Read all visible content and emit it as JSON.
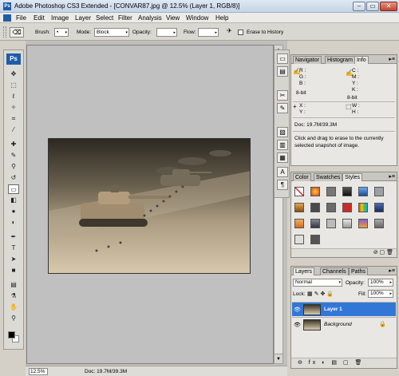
{
  "window": {
    "title": "Adobe Photoshop CS3 Extended - [CONVAR87.jpg @ 12.5% (Layer 1, RGB/8)]",
    "app_icon": "Ps",
    "min_label": "–",
    "max_label": "▭",
    "close_label": "✕"
  },
  "menu": [
    "File",
    "Edit",
    "Image",
    "Layer",
    "Select",
    "Filter",
    "Analysis",
    "View",
    "Window",
    "Help"
  ],
  "options": {
    "brush_label": "Brush:",
    "brush_size": "•",
    "mode_label": "Mode:",
    "mode_value": "Block",
    "opacity_label": "Opacity:",
    "opacity_value": "",
    "flow_label": "Flow:",
    "flow_value": "",
    "erase_history_label": "Erase to History",
    "tool_icon": "eraser-icon"
  },
  "toolbox": {
    "logo": "Ps",
    "tools": [
      {
        "name": "move-tool-icon",
        "glyph": "✥"
      },
      {
        "name": "marquee-tool-icon",
        "glyph": "⬚"
      },
      {
        "name": "lasso-tool-icon",
        "glyph": "ℓ"
      },
      {
        "name": "magic-wand-tool-icon",
        "glyph": "✧"
      },
      {
        "name": "crop-tool-icon",
        "glyph": "⌗"
      },
      {
        "name": "slice-tool-icon",
        "glyph": "⁄"
      },
      {
        "name": "healing-brush-tool-icon",
        "glyph": "✚"
      },
      {
        "name": "brush-tool-icon",
        "glyph": "✎"
      },
      {
        "name": "clone-stamp-tool-icon",
        "glyph": "⚲"
      },
      {
        "name": "history-brush-tool-icon",
        "glyph": "↺"
      },
      {
        "name": "eraser-tool-icon",
        "glyph": "▭"
      },
      {
        "name": "gradient-tool-icon",
        "glyph": "◧"
      },
      {
        "name": "blur-tool-icon",
        "glyph": "●"
      },
      {
        "name": "dodge-tool-icon",
        "glyph": "◐"
      },
      {
        "name": "pen-tool-icon",
        "glyph": "✒"
      },
      {
        "name": "type-tool-icon",
        "glyph": "T"
      },
      {
        "name": "path-selection-tool-icon",
        "glyph": "➤"
      },
      {
        "name": "shape-tool-icon",
        "glyph": "■"
      },
      {
        "name": "notes-tool-icon",
        "glyph": "▤"
      },
      {
        "name": "eyedropper-tool-icon",
        "glyph": "⚗"
      },
      {
        "name": "hand-tool-icon",
        "glyph": "✋"
      },
      {
        "name": "zoom-tool-icon",
        "glyph": "⚲"
      }
    ]
  },
  "status": {
    "zoom": "12.5%",
    "doc": "Doc: 19.7M/39.3M"
  },
  "info_panel": {
    "tabs": [
      "Navigator",
      "Histogram",
      "Info"
    ],
    "close_glyph": "×",
    "menu_glyph": "▸≡",
    "r": "R :",
    "g": "G :",
    "b": "B :",
    "c": "C :",
    "m": "M :",
    "y": "Y :",
    "k": "K :",
    "bit1": "8-bit",
    "bit2": "8-bit",
    "x": "X :",
    "y2": "Y :",
    "w": "W :",
    "h": "H :",
    "doc": "Doc: 19.7M/39.3M",
    "hint": "Click and drag to erase to the currently selected snapshot of image."
  },
  "styles_panel": {
    "tabs": [
      "Color",
      "Swatches",
      "Styles"
    ],
    "close_glyph": "×",
    "menu_glyph": "▸≡",
    "footer_icons": "⊘ ▢ 🗑"
  },
  "layers_panel": {
    "tabs": [
      "Layers",
      "Channels",
      "Paths"
    ],
    "close_glyph": "×",
    "menu_glyph": "▸≡",
    "blend_mode": "Normal",
    "opacity_label": "Opacity:",
    "opacity_value": "100%",
    "lock_label": "Lock:",
    "fill_label": "Fill:",
    "fill_value": "100%",
    "layers": [
      {
        "name": "Layer 1",
        "selected": true
      },
      {
        "name": "Background",
        "selected": false
      }
    ],
    "footer_icons": "⊖ fx ◐ ▤ ▢ 🗑"
  },
  "colors": {
    "accent": "#3277d6",
    "title_bar": "#c5d4e6"
  }
}
